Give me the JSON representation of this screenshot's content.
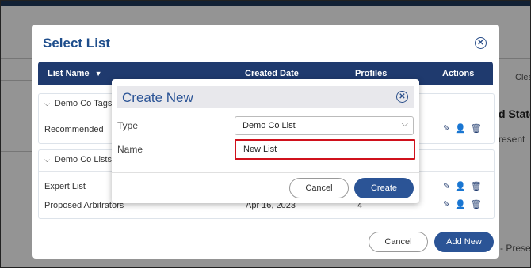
{
  "background": {
    "fragments": [
      "Clea",
      "d State",
      "resent",
      "- Prese"
    ]
  },
  "select_list": {
    "title": "Select List",
    "columns": {
      "list_name": "List Name",
      "sort_icon": "▼",
      "created_date": "Created Date",
      "profiles": "Profiles",
      "actions": "Actions"
    },
    "groups": [
      {
        "title": "Demo Co Tags",
        "rows": [
          {
            "name": "Recommended"
          }
        ]
      },
      {
        "title": "Demo Co Lists",
        "rows": [
          {
            "name": "Expert List"
          },
          {
            "name": "Proposed Arbitrators",
            "created": "Apr 16, 2023",
            "profiles": "4"
          }
        ]
      }
    ],
    "cancel_label": "Cancel",
    "add_new_label": "Add New"
  },
  "create_new": {
    "title": "Create New",
    "type_label": "Type",
    "type_value": "Demo Co List",
    "name_label": "Name",
    "name_value": "New List",
    "cancel_label": "Cancel",
    "create_label": "Create"
  },
  "colors": {
    "accent": "#2b5496",
    "header": "#1f3a6e",
    "highlight": "#d0111c"
  },
  "icons": [
    "close-icon",
    "chevron-down-icon",
    "edit-icon",
    "add-user-icon",
    "trash-icon",
    "sort-down-icon"
  ]
}
